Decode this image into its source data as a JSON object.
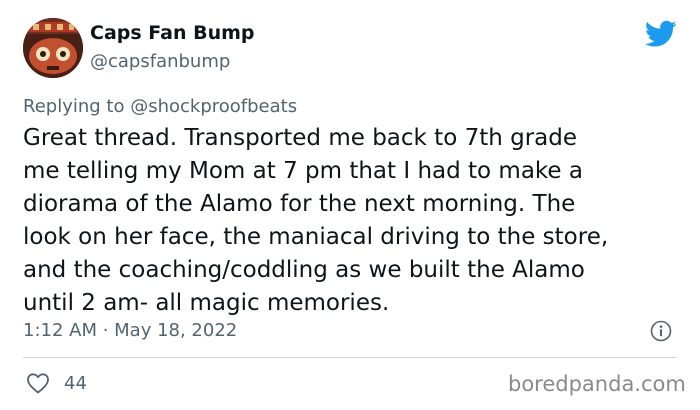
{
  "tweet": {
    "display_name": "Caps Fan Bump",
    "handle": "@capsfanbump",
    "replying_prefix": "Replying to",
    "replying_to": "@shockproofbeats",
    "body_lines": [
      "Great thread. Transported me back to 7th grade",
      "me telling my Mom at 7 pm that I had to make a",
      "diorama of the Alamo for the next morning. The",
      "look on her face, the maniacal driving to the store,",
      "and the coaching/coddling as we built the Alamo",
      "until 2 am- all magic memories."
    ],
    "timestamp": "1:12 AM · May 18, 2022",
    "likes": "44"
  },
  "watermark": "boredpanda.com",
  "icons": {
    "brand": "twitter-bird-icon",
    "info": "info-icon",
    "like": "heart-icon"
  },
  "colors": {
    "twitter_blue": "#1d9bf0",
    "text_primary": "#0f1419",
    "text_secondary": "#536471",
    "divider": "#cfd9de"
  }
}
